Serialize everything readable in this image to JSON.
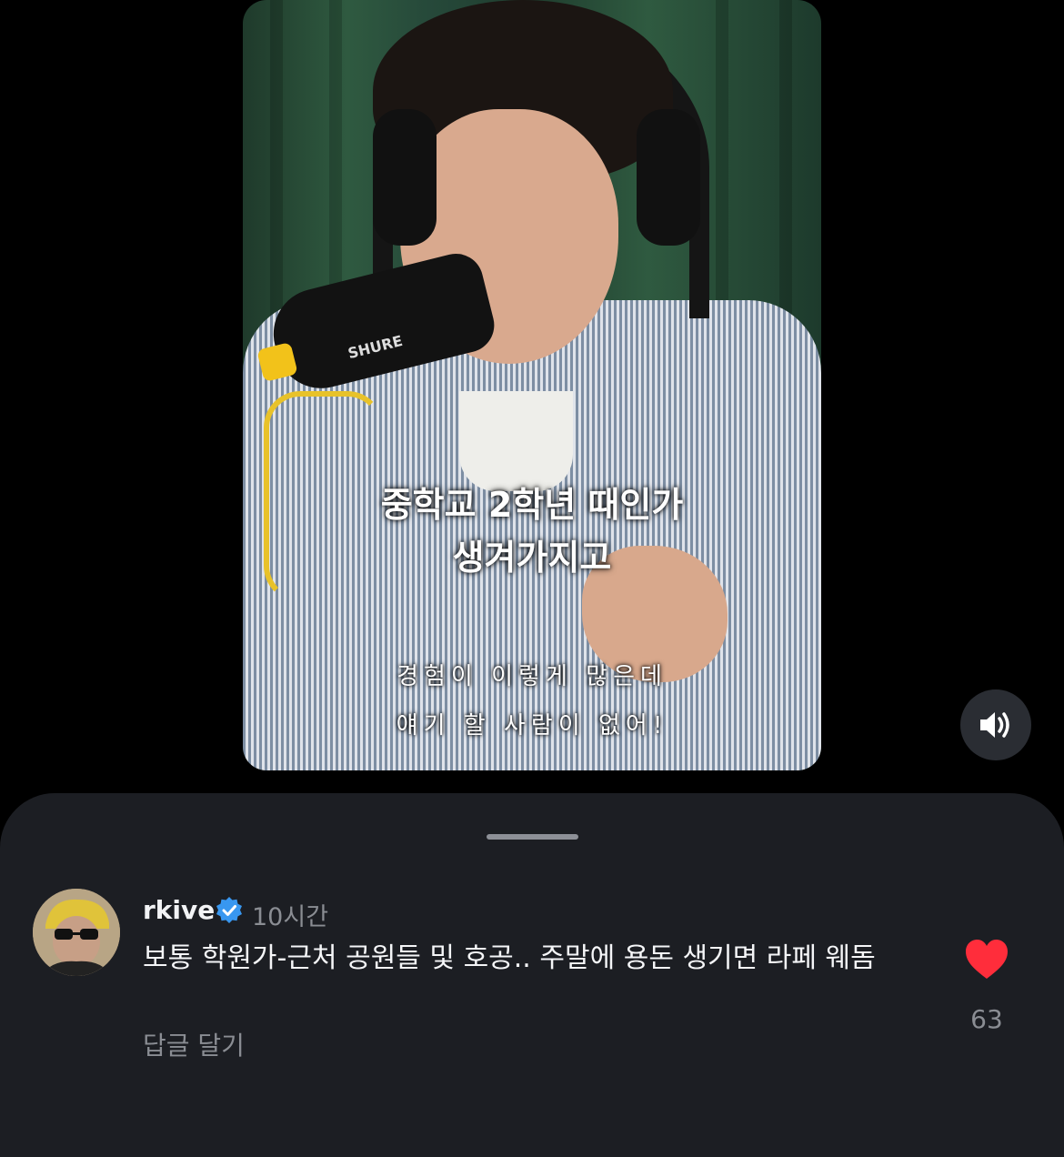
{
  "video": {
    "mic_brand": "SHURE",
    "subtitle_line1": "중학교 2학년 때인가",
    "subtitle_line2": "생겨가지고",
    "caption_line1": "경험이 이렇게 많은데",
    "caption_line2": "얘기 할 사람이 없어!"
  },
  "sound_button": {
    "icon": "speaker-volume-icon"
  },
  "comment_sheet": {
    "username": "rkive",
    "verified": true,
    "time": "10시간",
    "text": "보통 학원가-근처 공원들 및 호공.. 주말에 용돈 생기면 라페 웨돔",
    "reply_label": "답글 달기",
    "like_count": "63",
    "liked": true
  },
  "colors": {
    "background": "#000000",
    "sheet": "#1c1e23",
    "heart": "#ff2d3b",
    "verified": "#3897f0",
    "muted_text": "#8a8d93"
  }
}
